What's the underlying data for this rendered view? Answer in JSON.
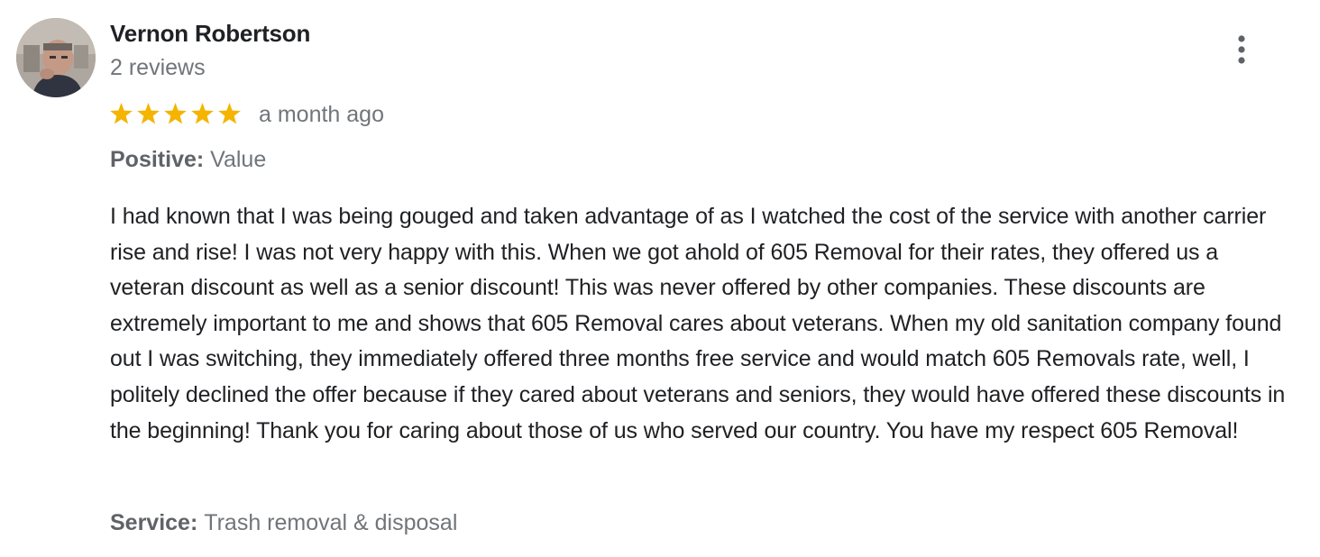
{
  "reviewer": {
    "name": "Vernon Robertson",
    "review_count": "2 reviews",
    "avatar_icon": "person-photo-avatar"
  },
  "menu": {
    "icon": "more-vert-icon"
  },
  "rating": {
    "stars": 5,
    "max_stars": 5,
    "star_color": "#f4b400",
    "date": "a month ago"
  },
  "attributes": {
    "positive_label": "Positive:",
    "positive_value": "Value",
    "service_label": "Service:",
    "service_value": "Trash removal & disposal"
  },
  "review_text": "I had known that I was being gouged and taken advantage of as I watched the cost of the service with another carrier rise and rise! I was not very happy with this. When we got ahold of 605 Removal for their rates, they offered us a veteran discount as well as a senior discount! This was never offered by other companies. These discounts are extremely important to me and shows that 605 Removal cares about veterans. When my old sanitation company found out I was switching, they immediately offered three months free service and would match 605 Removals rate, well, I politely declined the offer because if they cared about veterans and seniors, they would have offered these discounts in the beginning! Thank you for caring about those of us who served our country. You have my respect 605 Removal!",
  "colors": {
    "name_text": "#202124",
    "secondary_text": "#70757a",
    "label_text": "#5f6368",
    "icon_gray": "#5f6368"
  }
}
